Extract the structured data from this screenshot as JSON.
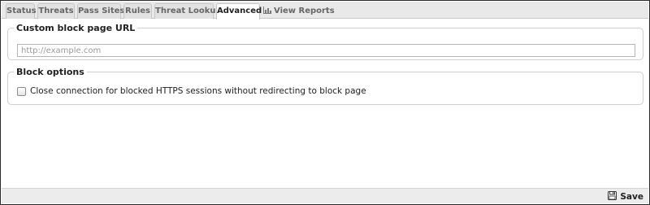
{
  "tabs": [
    {
      "label": "Status"
    },
    {
      "label": "Threats"
    },
    {
      "label": "Pass Sites"
    },
    {
      "label": "Rules"
    },
    {
      "label": "Threat Lookup"
    },
    {
      "label": "Advanced"
    },
    {
      "label": "View Reports"
    }
  ],
  "active_tab": "Advanced",
  "custom_block_page": {
    "legend": "Custom block page URL",
    "url_value": "",
    "url_placeholder": "http://example.com"
  },
  "block_options": {
    "legend": "Block options",
    "close_https_label": "Close connection for blocked HTTPS sessions without redirecting to block page",
    "close_https_checked": false
  },
  "footer": {
    "save_label": "Save"
  },
  "icons": {
    "view_reports": "bar-chart-icon",
    "save": "floppy-disk-icon"
  }
}
